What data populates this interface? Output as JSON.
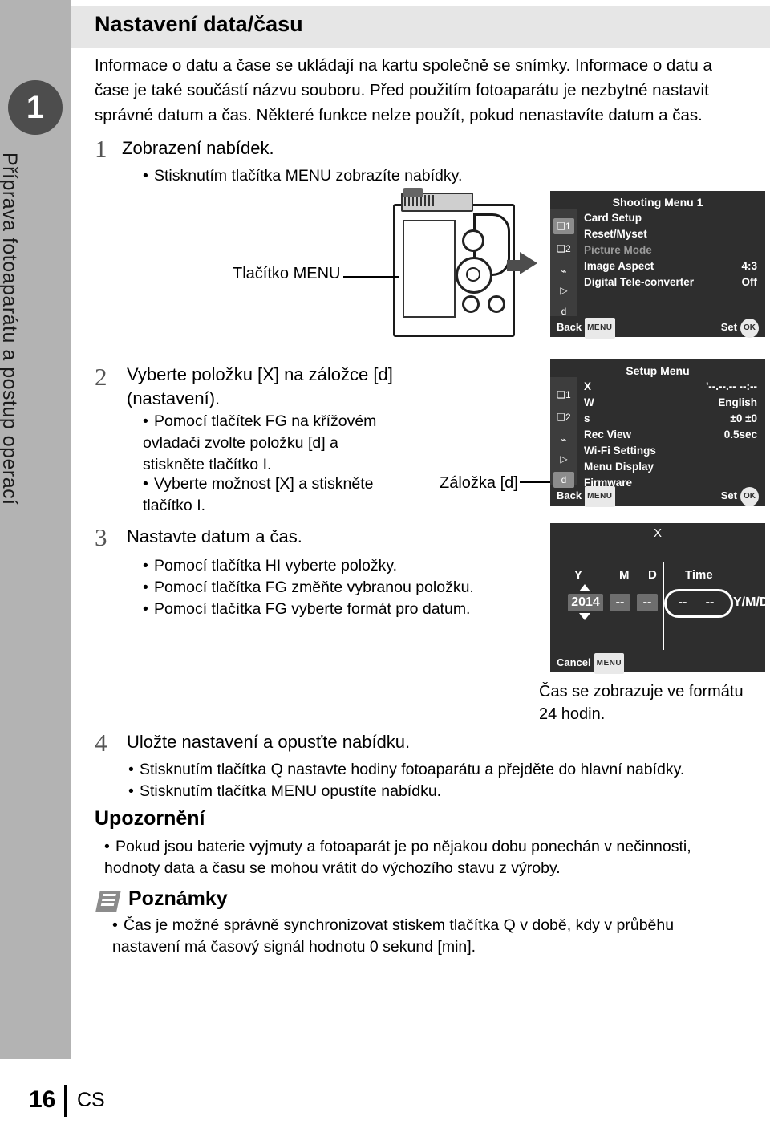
{
  "sidebar": {
    "chapter_number": "1",
    "vertical_title": "Příprava fotoaparátu a postup operací"
  },
  "header": {
    "title": "Nastavení data/času"
  },
  "intro": "Informace o datu a čase se ukládají na kartu společně se snímky. Informace o datu a čase je také součástí názvu souboru. Před použitím fotoaparátu je nezbytné nastavit správné datum a čas. Některé funkce nelze použít, pokud nenastavíte datum a čas.",
  "steps": [
    {
      "number": "1",
      "title": "Zobrazení nabídek.",
      "bullets": [
        "Stisknutím tlačítka MENU zobrazíte nabídky."
      ]
    },
    {
      "number": "2",
      "title": "Vyberte položku [X] na záložce [d] (nastavení).",
      "bullets": [
        "Pomocí tlačítek FG na křížovém ovladači zvolte položku [d] a stiskněte tlačítko I.",
        "Vyberte možnost [X] a stiskněte tlačítko I."
      ]
    },
    {
      "number": "3",
      "title": "Nastavte datum a čas.",
      "bullets": [
        "Pomocí tlačítka HI vyberte položky.",
        "Pomocí tlačítka FG změňte vybranou položku.",
        "Pomocí tlačítka FG vyberte formát pro datum."
      ]
    },
    {
      "number": "4",
      "title": "Uložte nastavení a opusťte nabídku.",
      "bullets": [
        "Stisknutím tlačítka Q nastavte hodiny fotoaparátu a přejděte do hlavní nabídky.",
        "Stisknutím tlačítka MENU opustíte nabídku."
      ]
    }
  ],
  "labels": {
    "menu_button": "Tlačítko MENU",
    "tab_label": "Záložka [d]",
    "time_format_caption": "Čas se zobrazuje ve formátu 24 hodin."
  },
  "screens": {
    "shooting_menu": {
      "title": "Shooting Menu 1",
      "rows": [
        {
          "label": "Card Setup",
          "value": "",
          "dim": false
        },
        {
          "label": "Reset/Myset",
          "value": "",
          "dim": false
        },
        {
          "label": "Picture Mode",
          "value": "",
          "dim": true
        },
        {
          "label": "Image Aspect",
          "value": "4:3",
          "dim": false
        },
        {
          "label": "Digital Tele-converter",
          "value": "Off",
          "dim": false
        }
      ],
      "footer_left": "Back",
      "footer_left_badge": "MENU",
      "footer_right": "Set",
      "footer_right_badge": "OK"
    },
    "setup_menu": {
      "title": "Setup Menu",
      "rows": [
        {
          "label": "X",
          "value": "'--.--.-- --:--",
          "dim": false
        },
        {
          "label": "W",
          "value": "English",
          "dim": false
        },
        {
          "label": "s",
          "value": "±0  ±0",
          "dim": false
        },
        {
          "label": "Rec View",
          "value": "0.5sec",
          "dim": false
        },
        {
          "label": "Wi-Fi Settings",
          "value": "",
          "dim": false
        },
        {
          "label": "Menu Display",
          "value": "",
          "dim": false
        },
        {
          "label": "Firmware",
          "value": "",
          "dim": false
        }
      ],
      "footer_left": "Back",
      "footer_left_badge": "MENU",
      "footer_right": "Set",
      "footer_right_badge": "OK"
    },
    "datetime": {
      "title": "X",
      "columns": [
        "Y",
        "M",
        "D",
        "Time"
      ],
      "values": [
        "2014",
        "--",
        "--",
        "--",
        "--"
      ],
      "format": "Y/M/D",
      "footer_left": "Cancel",
      "footer_left_badge": "MENU"
    }
  },
  "notes": {
    "warning_title": "Upozornění",
    "warning_bullets": [
      "Pokud jsou baterie vyjmuty a fotoaparát je po nějakou dobu ponechán v nečinnosti, hodnoty data a času se mohou vrátit do výchozího stavu z výroby."
    ],
    "tips_title": "Poznámky",
    "tips_bullets": [
      "Čas je možné správně synchronizovat stiskem tlačítka Q v době, kdy v průběhu nastavení má časový signál hodnotu 0 sekund [min]."
    ]
  },
  "footer": {
    "page": "16",
    "lang": "CS"
  }
}
